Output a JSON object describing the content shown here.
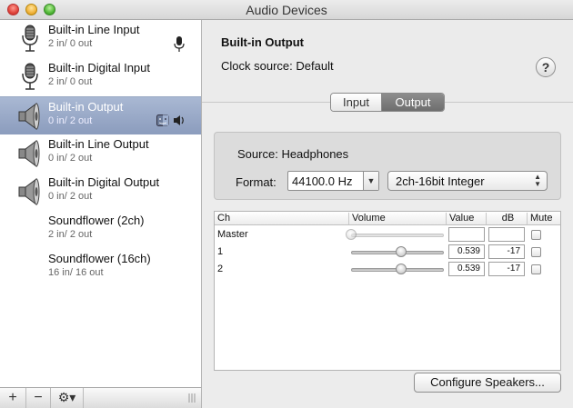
{
  "window": {
    "title": "Audio Devices"
  },
  "sidebar": {
    "devices": [
      {
        "name": "Built-in Line Input",
        "io": "2 in/ 0 out",
        "icon": "microphone-icon",
        "selected": false
      },
      {
        "name": "Built-in Digital Input",
        "io": "2 in/ 0 out",
        "icon": "microphone-icon",
        "selected": false
      },
      {
        "name": "Built-in Output",
        "io": "0 in/ 2 out",
        "icon": "speaker-icon",
        "selected": true
      },
      {
        "name": "Built-in Line Output",
        "io": "0 in/ 2 out",
        "icon": "speaker-icon",
        "selected": false
      },
      {
        "name": "Built-in Digital Output",
        "io": "0 in/ 2 out",
        "icon": "speaker-icon",
        "selected": false
      },
      {
        "name": "Soundflower (2ch)",
        "io": "2 in/ 2 out",
        "icon": "",
        "selected": false
      },
      {
        "name": "Soundflower (16ch)",
        "io": "16 in/ 16 out",
        "icon": "",
        "selected": false
      }
    ],
    "toolbar": {
      "add": "+",
      "remove": "−",
      "gear": "⚙▾"
    }
  },
  "main": {
    "device_title": "Built-in Output",
    "clock_label": "Clock source:",
    "clock_value": "Default",
    "help": "?",
    "tabs": [
      {
        "label": "Input",
        "active": false
      },
      {
        "label": "Output",
        "active": true
      }
    ],
    "source_label": "Source:",
    "source_value": "Headphones",
    "format_label": "Format:",
    "sample_rate": "44100.0 Hz",
    "bit_format": "2ch-16bit Integer",
    "table": {
      "headers": {
        "ch": "Ch",
        "volume": "Volume",
        "value": "Value",
        "db": "dB",
        "mute": "Mute"
      },
      "rows": [
        {
          "ch": "Master",
          "value": "",
          "db": "",
          "level": 0.0,
          "muted": false,
          "enabled": false
        },
        {
          "ch": "1",
          "value": "0.539",
          "db": "-17",
          "level": 0.539,
          "muted": false,
          "enabled": true
        },
        {
          "ch": "2",
          "value": "0.539",
          "db": "-17",
          "level": 0.539,
          "muted": false,
          "enabled": true
        }
      ]
    },
    "configure_label": "Configure Speakers..."
  }
}
